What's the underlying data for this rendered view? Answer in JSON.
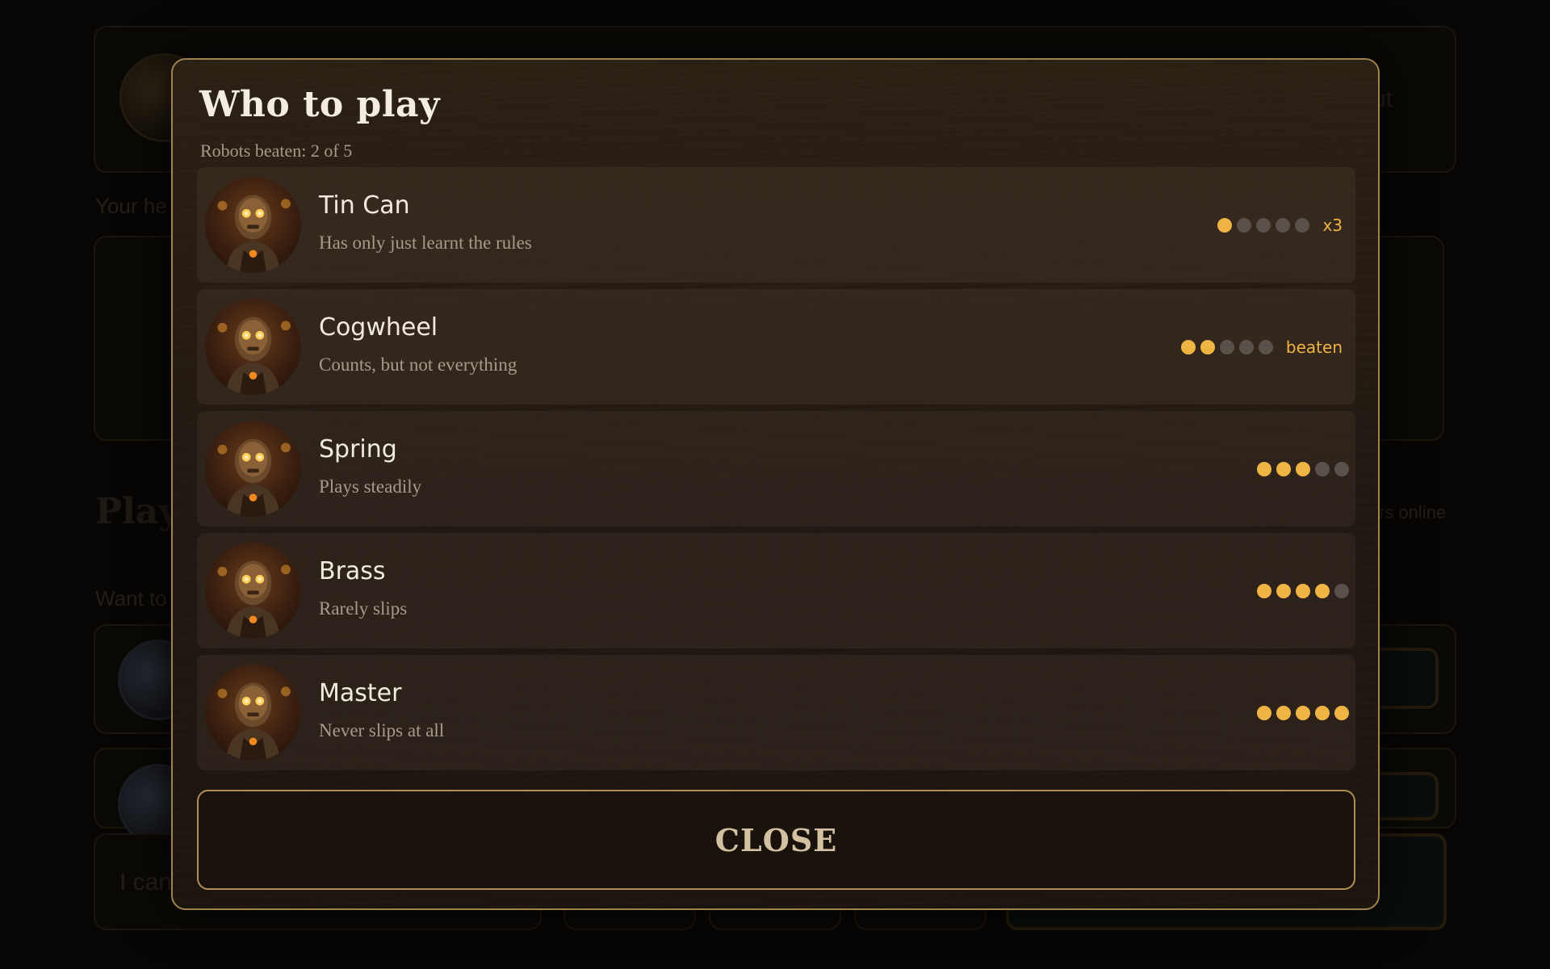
{
  "background": {
    "heading_fragment": "Play",
    "hint_fragment": "Your he",
    "want_fragment": "Want to",
    "online_fragment": "rs online",
    "logout_fragment": "ut",
    "input_fragment": "I can"
  },
  "modal": {
    "title": "Who to play",
    "subtitle": "Robots beaten: 2 of 5",
    "close_label": "CLOSE"
  },
  "robots": [
    {
      "name": "Tin Can",
      "description": "Has only just learnt the rules",
      "difficulty": 1,
      "max_difficulty": 5,
      "status": "x3"
    },
    {
      "name": "Cogwheel",
      "description": "Counts, but not everything",
      "difficulty": 2,
      "max_difficulty": 5,
      "status": "beaten"
    },
    {
      "name": "Spring",
      "description": "Plays steadily",
      "difficulty": 3,
      "max_difficulty": 5,
      "status": ""
    },
    {
      "name": "Brass",
      "description": "Rarely slips",
      "difficulty": 4,
      "max_difficulty": 5,
      "status": ""
    },
    {
      "name": "Master",
      "description": "Never slips at all",
      "difficulty": 5,
      "max_difficulty": 5,
      "status": ""
    }
  ],
  "colors": {
    "accent_gold": "#efb444",
    "modal_border": "#a0824c",
    "dot_off": "#5a524a"
  },
  "icons": {
    "portrait": "robot-portrait-icon"
  }
}
